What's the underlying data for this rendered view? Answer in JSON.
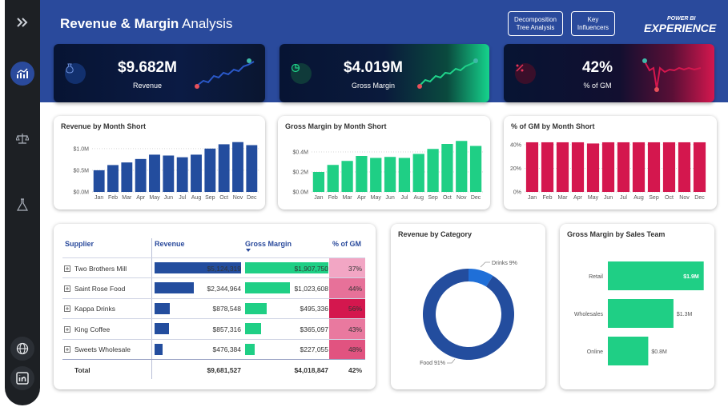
{
  "header": {
    "title_bold": "Revenue & Margin",
    "title_rest": " Analysis"
  },
  "nav": [
    {
      "label": "Decomposition Tree Analysis"
    },
    {
      "label": "Key Influencers"
    }
  ],
  "brand": {
    "top": "POWER BI",
    "main": "EXPERIENCE"
  },
  "kpis": [
    {
      "value": "$9.682M",
      "label": "Revenue",
      "icon": "money-bag-icon",
      "accent": "#e8505b",
      "line": "#2a58c8"
    },
    {
      "value": "$4.019M",
      "label": "Gross Margin",
      "icon": "pie-icon",
      "accent": "#1fd38a",
      "line": "#1fd38a"
    },
    {
      "value": "42%",
      "label": "% of GM",
      "icon": "percent-icon",
      "accent": "#e8355b",
      "line": "#d4174e"
    }
  ],
  "months": [
    "Jan",
    "Feb",
    "Mar",
    "Apr",
    "May",
    "Jun",
    "Jul",
    "Aug",
    "Sep",
    "Oct",
    "Nov",
    "Dec"
  ],
  "chart_data": [
    {
      "type": "bar",
      "title": "Revenue by Month Short",
      "categories": [
        "Jan",
        "Feb",
        "Mar",
        "Apr",
        "May",
        "Jun",
        "Jul",
        "Aug",
        "Sep",
        "Oct",
        "Nov",
        "Dec"
      ],
      "values": [
        0.5,
        0.62,
        0.68,
        0.76,
        0.86,
        0.84,
        0.8,
        0.86,
        1.0,
        1.1,
        1.15,
        1.08
      ],
      "ylim": [
        0,
        1.2
      ],
      "yticks": [
        "$0.0M",
        "$0.5M",
        "$1.0M"
      ],
      "ytick_values": [
        0,
        0.5,
        1.0
      ],
      "color": "#234d9e"
    },
    {
      "type": "bar",
      "title": "Gross Margin by Month Short",
      "categories": [
        "Jan",
        "Feb",
        "Mar",
        "Apr",
        "May",
        "Jun",
        "Jul",
        "Aug",
        "Sep",
        "Oct",
        "Nov",
        "Dec"
      ],
      "values": [
        0.2,
        0.27,
        0.31,
        0.36,
        0.34,
        0.35,
        0.34,
        0.38,
        0.43,
        0.48,
        0.51,
        0.46
      ],
      "ylim": [
        0,
        0.52
      ],
      "yticks": [
        "$0.0M",
        "$0.2M",
        "$0.4M"
      ],
      "ytick_values": [
        0,
        0.2,
        0.4
      ],
      "color": "#1fcf85"
    },
    {
      "type": "bar",
      "title": "% of GM by Month Short",
      "categories": [
        "Jan",
        "Feb",
        "Mar",
        "Apr",
        "May",
        "Jun",
        "Jul",
        "Aug",
        "Sep",
        "Oct",
        "Nov",
        "Dec"
      ],
      "values": [
        42,
        42,
        42,
        42,
        41,
        42,
        42,
        42,
        42,
        42,
        42,
        42
      ],
      "ylim": [
        0,
        44
      ],
      "yticks": [
        "0%",
        "20%",
        "40%"
      ],
      "ytick_values": [
        0,
        20,
        40
      ],
      "color": "#d4174e"
    },
    {
      "type": "pie",
      "title": "Revenue by Category",
      "categories": [
        "Drinks",
        "Food"
      ],
      "values": [
        9,
        91
      ],
      "labels": [
        "Drinks 9%",
        "Food 91%"
      ],
      "colors": [
        "#1f6fd8",
        "#234d9e"
      ]
    },
    {
      "type": "bar",
      "title": "Gross Margin by Sales Team",
      "categories": [
        "Retail",
        "Wholesales",
        "Online"
      ],
      "values": [
        1.9,
        1.3,
        0.8
      ],
      "labels": [
        "$1.9M",
        "$1.3M",
        "$0.8M"
      ],
      "xlim": [
        0,
        2.0
      ],
      "color": "#1fcf85"
    }
  ],
  "table": {
    "headers": [
      "Supplier",
      "Revenue",
      "Gross Margin",
      "% of GM"
    ],
    "rows": [
      {
        "supplier": "Two Brothers Mill",
        "revenue": "$5,124,319",
        "rev": 5124319,
        "gm": "$1,907,750",
        "gmv": 1907750,
        "pct": "37%",
        "pctv": 37
      },
      {
        "supplier": "Saint Rose Food",
        "revenue": "$2,344,964",
        "rev": 2344964,
        "gm": "$1,023,608",
        "gmv": 1023608,
        "pct": "44%",
        "pctv": 44
      },
      {
        "supplier": "Kappa Drinks",
        "revenue": "$878,548",
        "rev": 878548,
        "gm": "$495,336",
        "gmv": 495336,
        "pct": "56%",
        "pctv": 56
      },
      {
        "supplier": "King Coffee",
        "revenue": "$857,316",
        "rev": 857316,
        "gm": "$365,097",
        "gmv": 365097,
        "pct": "43%",
        "pctv": 43
      },
      {
        "supplier": "Sweets Wholesale",
        "revenue": "$476,384",
        "rev": 476384,
        "gm": "$227,055",
        "gmv": 227055,
        "pct": "48%",
        "pctv": 48
      }
    ],
    "total": {
      "label": "Total",
      "revenue": "$9,681,527",
      "gm": "$4,018,847",
      "pct": "42%"
    }
  }
}
